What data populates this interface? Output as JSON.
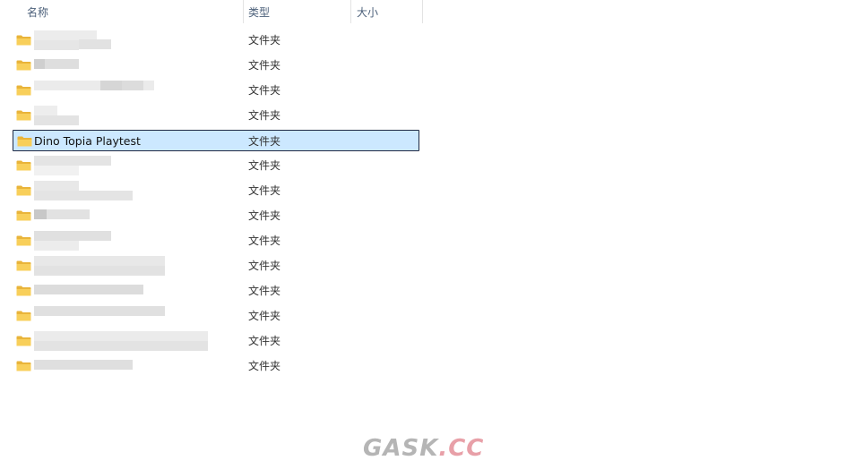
{
  "columns": {
    "name": "名称",
    "type": "类型",
    "size": "大小"
  },
  "sort_indicator": "^",
  "rows": [
    {
      "name": "",
      "type": "文件夹",
      "selected": false,
      "redacted": true
    },
    {
      "name": "",
      "type": "文件夹",
      "selected": false,
      "redacted": true
    },
    {
      "name": "",
      "type": "文件夹",
      "selected": false,
      "redacted": true
    },
    {
      "name": "",
      "type": "文件夹",
      "selected": false,
      "redacted": true
    },
    {
      "name": "Dino Topia Playtest",
      "type": "文件夹",
      "selected": true,
      "redacted": false
    },
    {
      "name": "",
      "type": "文件夹",
      "selected": false,
      "redacted": true
    },
    {
      "name": "",
      "type": "文件夹",
      "selected": false,
      "redacted": true
    },
    {
      "name": "",
      "type": "文件夹",
      "selected": false,
      "redacted": true
    },
    {
      "name": "",
      "type": "文件夹",
      "selected": false,
      "redacted": true
    },
    {
      "name": "",
      "type": "文件夹",
      "selected": false,
      "redacted": true
    },
    {
      "name": "",
      "type": "文件夹",
      "selected": false,
      "redacted": true
    },
    {
      "name": "",
      "type": "文件夹",
      "selected": false,
      "redacted": true
    },
    {
      "name": "",
      "type": "文件夹",
      "selected": false,
      "redacted": true
    },
    {
      "name": "",
      "type": "文件夹",
      "selected": false,
      "redacted": true
    }
  ],
  "watermark": {
    "main": "GASK",
    "suffix": ".CC"
  },
  "colors": {
    "selection_bg": "#cce8ff",
    "selection_border": "#1f2a44",
    "folder_yellow": "#f8cf5a",
    "header_text": "#4c607a"
  },
  "icons": {
    "folder": "folder-icon",
    "sort": "sort-up-icon"
  }
}
